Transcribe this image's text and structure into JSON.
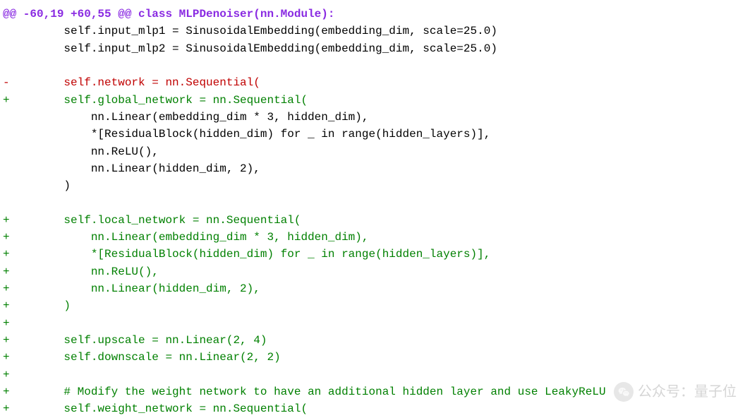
{
  "diff": {
    "hunk_header": "@@ -60,19 +60,55 @@ class MLPDenoiser(nn.Module):",
    "lines": [
      {
        "type": "context",
        "text": "         self.input_mlp1 = SinusoidalEmbedding(embedding_dim, scale=25.0)"
      },
      {
        "type": "context",
        "text": "         self.input_mlp2 = SinusoidalEmbedding(embedding_dim, scale=25.0)"
      },
      {
        "type": "context",
        "text": " "
      },
      {
        "type": "removed",
        "text": "-        self.network = nn.Sequential("
      },
      {
        "type": "added",
        "text": "+        self.global_network = nn.Sequential("
      },
      {
        "type": "context",
        "text": "             nn.Linear(embedding_dim * 3, hidden_dim),"
      },
      {
        "type": "context",
        "text": "             *[ResidualBlock(hidden_dim) for _ in range(hidden_layers)],"
      },
      {
        "type": "context",
        "text": "             nn.ReLU(),"
      },
      {
        "type": "context",
        "text": "             nn.Linear(hidden_dim, 2),"
      },
      {
        "type": "context",
        "text": "         )"
      },
      {
        "type": "context",
        "text": " "
      },
      {
        "type": "added",
        "text": "+        self.local_network = nn.Sequential("
      },
      {
        "type": "added",
        "text": "+            nn.Linear(embedding_dim * 3, hidden_dim),"
      },
      {
        "type": "added",
        "text": "+            *[ResidualBlock(hidden_dim) for _ in range(hidden_layers)],"
      },
      {
        "type": "added",
        "text": "+            nn.ReLU(),"
      },
      {
        "type": "added",
        "text": "+            nn.Linear(hidden_dim, 2),"
      },
      {
        "type": "added",
        "text": "+        )"
      },
      {
        "type": "added",
        "text": "+"
      },
      {
        "type": "added",
        "text": "+        self.upscale = nn.Linear(2, 4)"
      },
      {
        "type": "added",
        "text": "+        self.downscale = nn.Linear(2, 2)"
      },
      {
        "type": "added",
        "text": "+"
      },
      {
        "type": "added",
        "text": "+        # Modify the weight network to have an additional hidden layer and use LeakyReLU"
      },
      {
        "type": "added",
        "text": "+        self.weight_network = nn.Sequential("
      }
    ]
  },
  "watermark": {
    "label": "公众号：量子位"
  }
}
